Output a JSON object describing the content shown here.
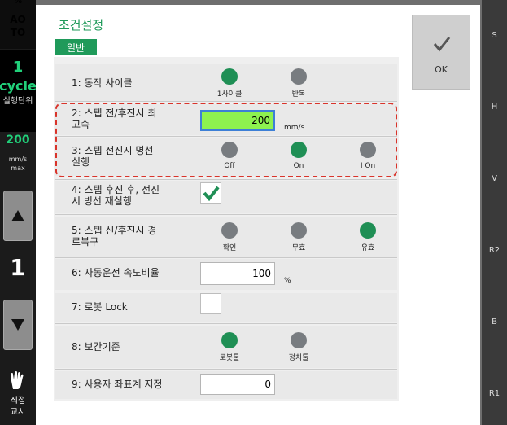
{
  "left_panel": {
    "percent": "%",
    "mode": "AUTO",
    "mode_line1": "AO",
    "mode_line2": "TO",
    "cycle_count": "1",
    "cycle_label": "cycle",
    "cycle_sub": "실행단위",
    "speed_value": "200",
    "speed_unit1": "mm/s",
    "speed_unit2": "max",
    "step_number": "1",
    "direct_teach_line1": "직접",
    "direct_teach_line2": "교시"
  },
  "dialog": {
    "title": "조건설정",
    "tab_general": "일반",
    "ok_label": "OK"
  },
  "rows": {
    "r1": {
      "label": "1: 동작 사이클",
      "opt1": "1사이클",
      "opt2": "반복"
    },
    "r2": {
      "label_line1": "2: 스텝 전/후진시 최",
      "label_line2": "고속",
      "value": "200",
      "unit": "mm/s"
    },
    "r3": {
      "label_line1": "3: 스텝 전진시 명선",
      "label_line2": "실행",
      "opt1": "Off",
      "opt2": "On",
      "opt3": "I On"
    },
    "r4": {
      "label_line1": "4: 스텝 후진 후, 전진",
      "label_line2": "시 빙선 재실행"
    },
    "r5": {
      "label_line1": "5: 스텝 신/후진시 경",
      "label_line2": "로복구",
      "opt1": "확인",
      "opt2": "무효",
      "opt3": "유효"
    },
    "r6": {
      "label": "6: 자동운전 속도비율",
      "value": "100",
      "unit": "%"
    },
    "r7": {
      "label": "7: 로봇 Lock"
    },
    "r8": {
      "label": "8: 보간기준",
      "opt1": "로봇툴",
      "opt2": "정치툴"
    },
    "r9": {
      "label": "9: 사용자 좌표계 지정",
      "value": "0"
    }
  },
  "right_panel": {
    "keys": [
      "S",
      "H",
      "V",
      "R2",
      "B",
      "R1"
    ]
  },
  "colors": {
    "accent_green": "#1f9a5a",
    "radio_on": "#1f8f55",
    "radio_off": "#787c80",
    "active_field": "#8ef24f",
    "highlight_dash": "#d9342b"
  }
}
